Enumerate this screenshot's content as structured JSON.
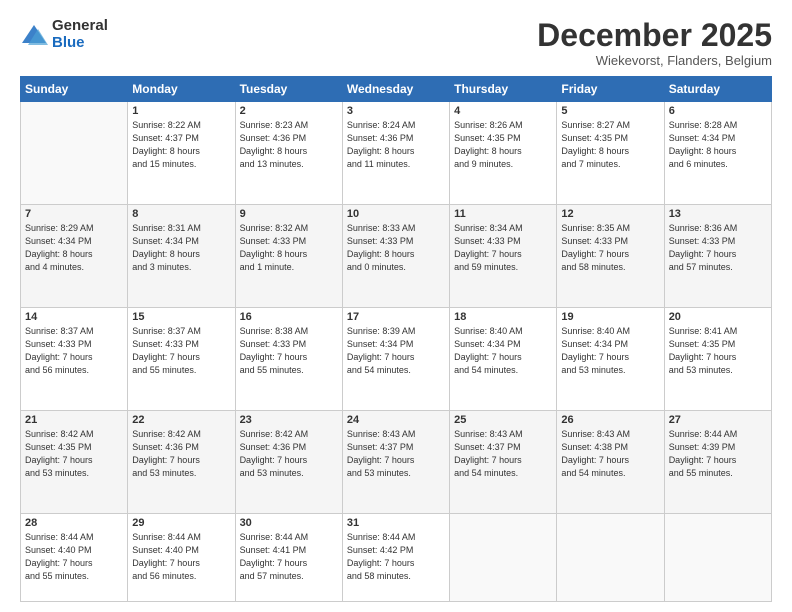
{
  "logo": {
    "general": "General",
    "blue": "Blue"
  },
  "header": {
    "month": "December 2025",
    "location": "Wiekevorst, Flanders, Belgium"
  },
  "weekdays": [
    "Sunday",
    "Monday",
    "Tuesday",
    "Wednesday",
    "Thursday",
    "Friday",
    "Saturday"
  ],
  "weeks": [
    [
      {
        "day": "",
        "info": ""
      },
      {
        "day": "1",
        "info": "Sunrise: 8:22 AM\nSunset: 4:37 PM\nDaylight: 8 hours\nand 15 minutes."
      },
      {
        "day": "2",
        "info": "Sunrise: 8:23 AM\nSunset: 4:36 PM\nDaylight: 8 hours\nand 13 minutes."
      },
      {
        "day": "3",
        "info": "Sunrise: 8:24 AM\nSunset: 4:36 PM\nDaylight: 8 hours\nand 11 minutes."
      },
      {
        "day": "4",
        "info": "Sunrise: 8:26 AM\nSunset: 4:35 PM\nDaylight: 8 hours\nand 9 minutes."
      },
      {
        "day": "5",
        "info": "Sunrise: 8:27 AM\nSunset: 4:35 PM\nDaylight: 8 hours\nand 7 minutes."
      },
      {
        "day": "6",
        "info": "Sunrise: 8:28 AM\nSunset: 4:34 PM\nDaylight: 8 hours\nand 6 minutes."
      }
    ],
    [
      {
        "day": "7",
        "info": "Sunrise: 8:29 AM\nSunset: 4:34 PM\nDaylight: 8 hours\nand 4 minutes."
      },
      {
        "day": "8",
        "info": "Sunrise: 8:31 AM\nSunset: 4:34 PM\nDaylight: 8 hours\nand 3 minutes."
      },
      {
        "day": "9",
        "info": "Sunrise: 8:32 AM\nSunset: 4:33 PM\nDaylight: 8 hours\nand 1 minute."
      },
      {
        "day": "10",
        "info": "Sunrise: 8:33 AM\nSunset: 4:33 PM\nDaylight: 8 hours\nand 0 minutes."
      },
      {
        "day": "11",
        "info": "Sunrise: 8:34 AM\nSunset: 4:33 PM\nDaylight: 7 hours\nand 59 minutes."
      },
      {
        "day": "12",
        "info": "Sunrise: 8:35 AM\nSunset: 4:33 PM\nDaylight: 7 hours\nand 58 minutes."
      },
      {
        "day": "13",
        "info": "Sunrise: 8:36 AM\nSunset: 4:33 PM\nDaylight: 7 hours\nand 57 minutes."
      }
    ],
    [
      {
        "day": "14",
        "info": "Sunrise: 8:37 AM\nSunset: 4:33 PM\nDaylight: 7 hours\nand 56 minutes."
      },
      {
        "day": "15",
        "info": "Sunrise: 8:37 AM\nSunset: 4:33 PM\nDaylight: 7 hours\nand 55 minutes."
      },
      {
        "day": "16",
        "info": "Sunrise: 8:38 AM\nSunset: 4:33 PM\nDaylight: 7 hours\nand 55 minutes."
      },
      {
        "day": "17",
        "info": "Sunrise: 8:39 AM\nSunset: 4:34 PM\nDaylight: 7 hours\nand 54 minutes."
      },
      {
        "day": "18",
        "info": "Sunrise: 8:40 AM\nSunset: 4:34 PM\nDaylight: 7 hours\nand 54 minutes."
      },
      {
        "day": "19",
        "info": "Sunrise: 8:40 AM\nSunset: 4:34 PM\nDaylight: 7 hours\nand 53 minutes."
      },
      {
        "day": "20",
        "info": "Sunrise: 8:41 AM\nSunset: 4:35 PM\nDaylight: 7 hours\nand 53 minutes."
      }
    ],
    [
      {
        "day": "21",
        "info": "Sunrise: 8:42 AM\nSunset: 4:35 PM\nDaylight: 7 hours\nand 53 minutes."
      },
      {
        "day": "22",
        "info": "Sunrise: 8:42 AM\nSunset: 4:36 PM\nDaylight: 7 hours\nand 53 minutes."
      },
      {
        "day": "23",
        "info": "Sunrise: 8:42 AM\nSunset: 4:36 PM\nDaylight: 7 hours\nand 53 minutes."
      },
      {
        "day": "24",
        "info": "Sunrise: 8:43 AM\nSunset: 4:37 PM\nDaylight: 7 hours\nand 53 minutes."
      },
      {
        "day": "25",
        "info": "Sunrise: 8:43 AM\nSunset: 4:37 PM\nDaylight: 7 hours\nand 54 minutes."
      },
      {
        "day": "26",
        "info": "Sunrise: 8:43 AM\nSunset: 4:38 PM\nDaylight: 7 hours\nand 54 minutes."
      },
      {
        "day": "27",
        "info": "Sunrise: 8:44 AM\nSunset: 4:39 PM\nDaylight: 7 hours\nand 55 minutes."
      }
    ],
    [
      {
        "day": "28",
        "info": "Sunrise: 8:44 AM\nSunset: 4:40 PM\nDaylight: 7 hours\nand 55 minutes."
      },
      {
        "day": "29",
        "info": "Sunrise: 8:44 AM\nSunset: 4:40 PM\nDaylight: 7 hours\nand 56 minutes."
      },
      {
        "day": "30",
        "info": "Sunrise: 8:44 AM\nSunset: 4:41 PM\nDaylight: 7 hours\nand 57 minutes."
      },
      {
        "day": "31",
        "info": "Sunrise: 8:44 AM\nSunset: 4:42 PM\nDaylight: 7 hours\nand 58 minutes."
      },
      {
        "day": "",
        "info": ""
      },
      {
        "day": "",
        "info": ""
      },
      {
        "day": "",
        "info": ""
      }
    ]
  ]
}
